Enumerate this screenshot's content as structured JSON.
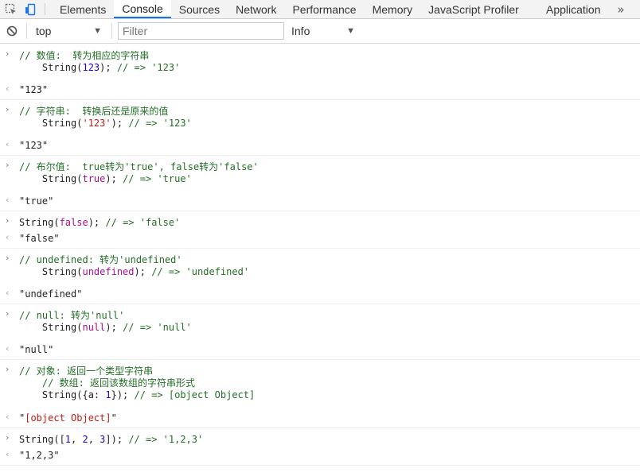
{
  "tabs": [
    "Elements",
    "Console",
    "Sources",
    "Network",
    "Performance",
    "Memory",
    "JavaScript Profiler",
    "Application"
  ],
  "filterbar": {
    "context": "top",
    "filter_placeholder": "Filter",
    "level": "Info"
  },
  "entries": [
    {
      "kind": "in",
      "lines": [
        [
          {
            "t": "com",
            "s": "// 数值:  转为相应的字符串"
          }
        ],
        [
          {
            "t": "plain",
            "s": "    String("
          },
          {
            "t": "num",
            "s": "123"
          },
          {
            "t": "plain",
            "s": "); "
          },
          {
            "t": "com",
            "s": "// => '123'"
          }
        ]
      ]
    },
    {
      "kind": "out",
      "text": "\"123\""
    },
    {
      "kind": "in",
      "lines": [
        [
          {
            "t": "com",
            "s": "// 字符串:  转换后还是原来的值"
          }
        ],
        [
          {
            "t": "plain",
            "s": "    String("
          },
          {
            "t": "str",
            "s": "'123'"
          },
          {
            "t": "plain",
            "s": "); "
          },
          {
            "t": "com",
            "s": "// => '123'"
          }
        ]
      ]
    },
    {
      "kind": "out",
      "text": "\"123\""
    },
    {
      "kind": "in",
      "lines": [
        [
          {
            "t": "com",
            "s": "// 布尔值:  true转为'true', false转为'false'"
          }
        ],
        [
          {
            "t": "plain",
            "s": "    String("
          },
          {
            "t": "kw",
            "s": "true"
          },
          {
            "t": "plain",
            "s": "); "
          },
          {
            "t": "com",
            "s": "// => 'true'"
          }
        ]
      ]
    },
    {
      "kind": "out",
      "text": "\"true\""
    },
    {
      "kind": "in",
      "lines": [
        [
          {
            "t": "plain",
            "s": "String("
          },
          {
            "t": "kw",
            "s": "false"
          },
          {
            "t": "plain",
            "s": "); "
          },
          {
            "t": "com",
            "s": "// => 'false'"
          }
        ]
      ]
    },
    {
      "kind": "out",
      "text": "\"false\""
    },
    {
      "kind": "in",
      "lines": [
        [
          {
            "t": "com",
            "s": "// undefined: 转为'undefined'"
          }
        ],
        [
          {
            "t": "plain",
            "s": "    String("
          },
          {
            "t": "kw",
            "s": "undefined"
          },
          {
            "t": "plain",
            "s": "); "
          },
          {
            "t": "com",
            "s": "// => 'undefined'"
          }
        ]
      ]
    },
    {
      "kind": "out",
      "text": "\"undefined\""
    },
    {
      "kind": "in",
      "lines": [
        [
          {
            "t": "com",
            "s": "// null: 转为'null'"
          }
        ],
        [
          {
            "t": "plain",
            "s": "    String("
          },
          {
            "t": "kw",
            "s": "null"
          },
          {
            "t": "plain",
            "s": "); "
          },
          {
            "t": "com",
            "s": "// => 'null'"
          }
        ]
      ]
    },
    {
      "kind": "out",
      "text": "\"null\""
    },
    {
      "kind": "in",
      "lines": [
        [
          {
            "t": "com",
            "s": "// 对象: 返回一个类型字符串"
          }
        ],
        [
          {
            "t": "com",
            "s": "    // 数组: 返回该数组的字符串形式"
          }
        ],
        [
          {
            "t": "plain",
            "s": "    String({a: "
          },
          {
            "t": "num",
            "s": "1"
          },
          {
            "t": "plain",
            "s": "}); "
          },
          {
            "t": "com",
            "s": "// => [object Object]"
          }
        ]
      ]
    },
    {
      "kind": "out",
      "text": "\"[object Object]\""
    },
    {
      "kind": "in",
      "lines": [
        [
          {
            "t": "plain",
            "s": "String(["
          },
          {
            "t": "num",
            "s": "1"
          },
          {
            "t": "plain",
            "s": ", "
          },
          {
            "t": "num",
            "s": "2"
          },
          {
            "t": "plain",
            "s": ", "
          },
          {
            "t": "num",
            "s": "3"
          },
          {
            "t": "plain",
            "s": "]); "
          },
          {
            "t": "com",
            "s": "// => '1,2,3'"
          }
        ]
      ]
    },
    {
      "kind": "out",
      "text": "\"1,2,3\""
    }
  ]
}
